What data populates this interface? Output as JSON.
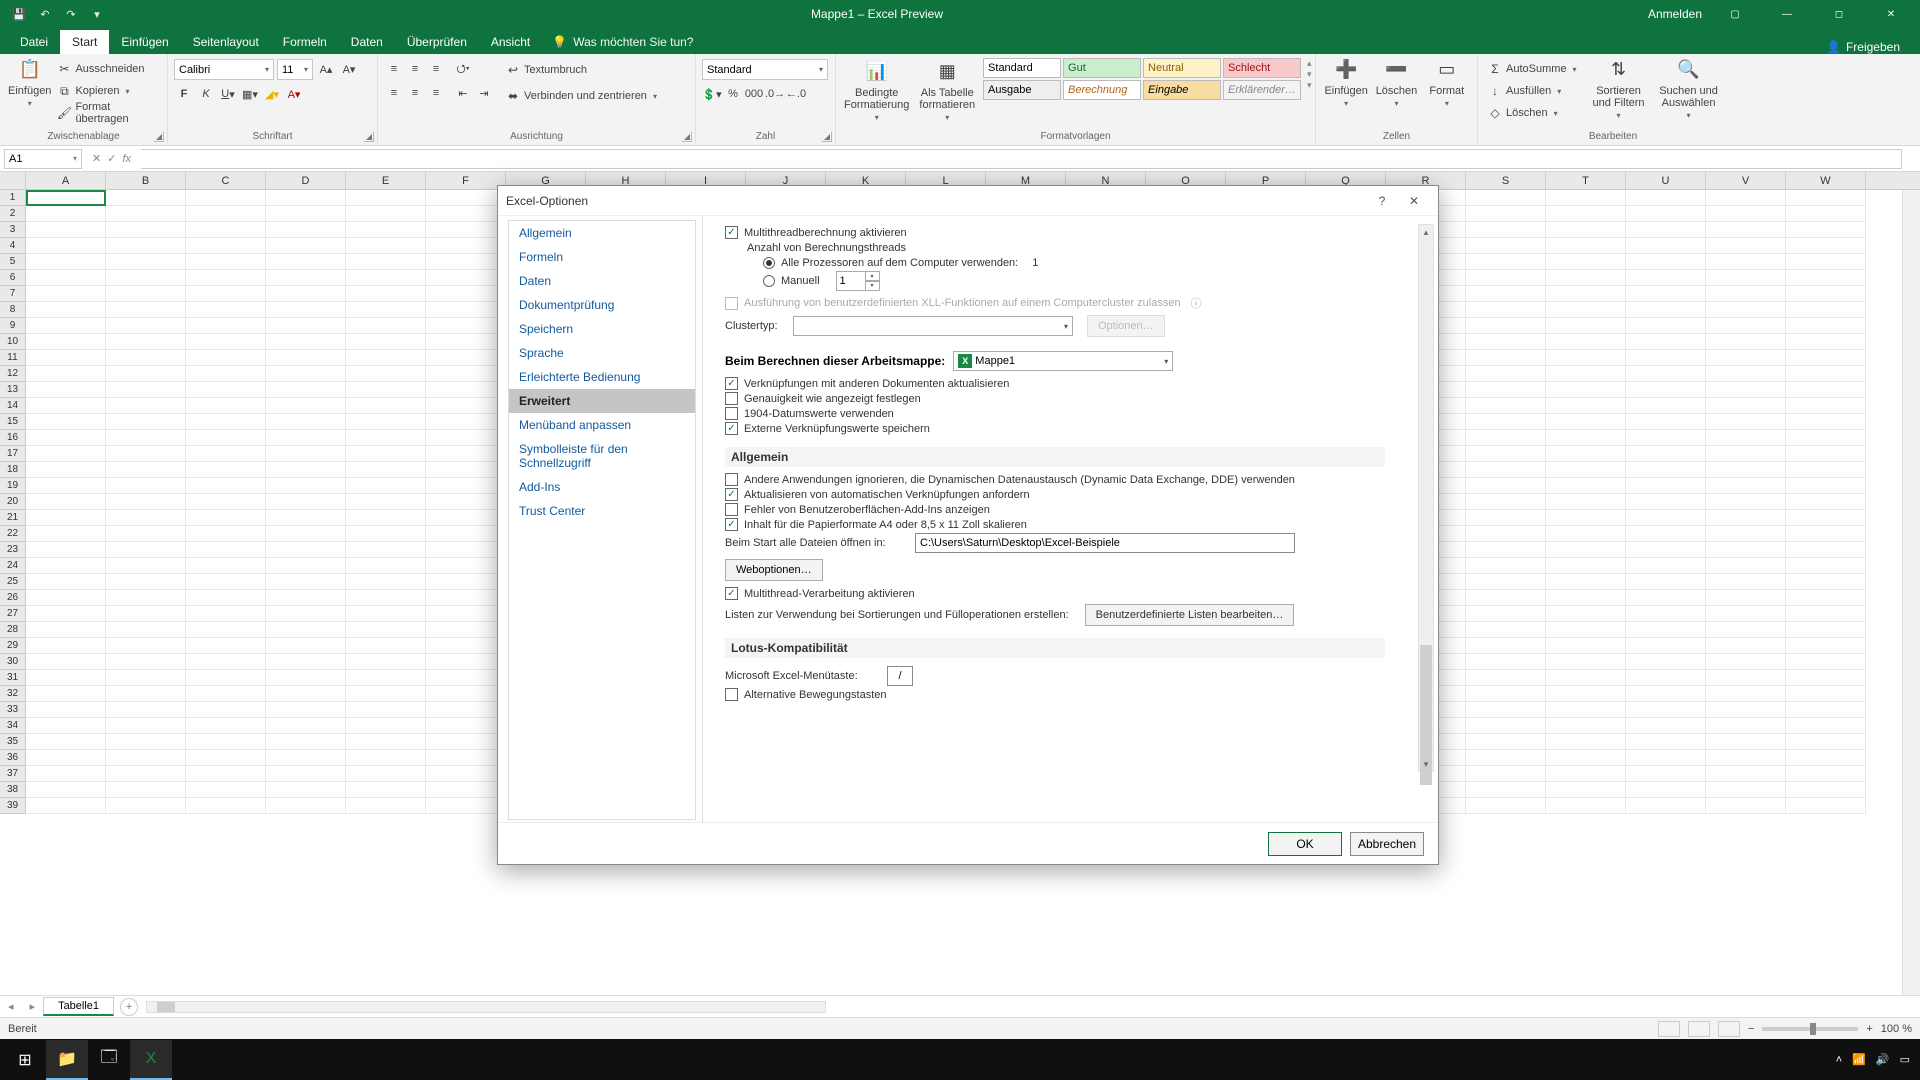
{
  "titlebar": {
    "title": "Mappe1  –  Excel Preview",
    "signin": "Anmelden"
  },
  "tabs": {
    "file": "Datei",
    "home": "Start",
    "insert": "Einfügen",
    "layout": "Seitenlayout",
    "formulas": "Formeln",
    "data": "Daten",
    "review": "Überprüfen",
    "view": "Ansicht",
    "tellme": "Was möchten Sie tun?",
    "share": "Freigeben"
  },
  "ribbon": {
    "clipboard": {
      "label": "Zwischenablage",
      "paste": "Einfügen",
      "cut": "Ausschneiden",
      "copy": "Kopieren",
      "painter": "Format übertragen"
    },
    "font": {
      "label": "Schriftart",
      "name": "Calibri",
      "size": "11"
    },
    "align": {
      "label": "Ausrichtung",
      "wrap": "Textumbruch",
      "merge": "Verbinden und zentrieren"
    },
    "number": {
      "label": "Zahl",
      "format": "Standard"
    },
    "styles": {
      "label": "Formatvorlagen",
      "cond": "Bedingte Formatierung",
      "table": "Als Tabelle formatieren",
      "standard": "Standard",
      "gut": "Gut",
      "neutral": "Neutral",
      "schlecht": "Schlecht",
      "ausgabe": "Ausgabe",
      "berechnung": "Berechnung",
      "eingabe": "Eingabe",
      "erkl": "Erklärender…"
    },
    "cells": {
      "label": "Zellen",
      "insert": "Einfügen",
      "delete": "Löschen",
      "format": "Format"
    },
    "editing": {
      "label": "Bearbeiten",
      "sum": "AutoSumme",
      "fill": "Ausfüllen",
      "clear": "Löschen",
      "sort": "Sortieren und Filtern",
      "find": "Suchen und Auswählen"
    }
  },
  "formula": {
    "cellref": "A1"
  },
  "sheet": {
    "tab": "Tabelle1"
  },
  "status": {
    "ready": "Bereit",
    "zoom": "100 %"
  },
  "dialog": {
    "title": "Excel-Optionen",
    "nav": [
      "Allgemein",
      "Formeln",
      "Daten",
      "Dokumentprüfung",
      "Speichern",
      "Sprache",
      "Erleichterte Bedienung",
      "Erweitert",
      "Menüband anpassen",
      "Symbolleiste für den Schnellzugriff",
      "Add-Ins",
      "Trust Center"
    ],
    "nav_active_index": 7,
    "threads": {
      "multithread": "Multithreadberechnung aktivieren",
      "count_label": "Anzahl von Berechnungsthreads",
      "all_cpu": "Alle Prozessoren auf dem Computer verwenden:",
      "all_cpu_val": "1",
      "manual": "Manuell",
      "manual_val": "1",
      "xll": "Ausführung von benutzerdefinierten XLL-Funktionen auf einem Computercluster zulassen",
      "clustertype": "Clustertyp:",
      "options": "Optionen…"
    },
    "calc": {
      "header": "Beim Berechnen dieser Arbeitsmappe:",
      "workbook": "Mappe1",
      "links": "Verknüpfungen mit anderen Dokumenten aktualisieren",
      "precision": "Genauigkeit wie angezeigt festlegen",
      "date1904": "1904-Datumswerte verwenden",
      "ext_links": "Externe Verknüpfungswerte speichern"
    },
    "general": {
      "header": "Allgemein",
      "dde": "Andere Anwendungen ignorieren, die Dynamischen Datenaustausch (Dynamic Data Exchange, DDE) verwenden",
      "ask_links": "Aktualisieren von automatischen Verknüpfungen anfordern",
      "addin_err": "Fehler von Benutzeroberflächen-Add-Ins anzeigen",
      "scale": "Inhalt für die Papierformate A4 oder 8,5 x 11 Zoll skalieren",
      "startup_lbl": "Beim Start alle Dateien öffnen in:",
      "startup_val": "C:\\Users\\Saturn\\Desktop\\Excel-Beispiele",
      "webopt": "Weboptionen…",
      "multithread_proc": "Multithread-Verarbeitung aktivieren",
      "lists_lbl": "Listen zur Verwendung bei Sortierungen und Fülloperationen erstellen:",
      "lists_btn": "Benutzerdefinierte Listen bearbeiten…"
    },
    "lotus": {
      "header": "Lotus-Kompatibilität",
      "menukey": "Microsoft Excel-Menütaste:",
      "menukey_val": "/",
      "altmove": "Alternative Bewegungstasten"
    },
    "ok": "OK",
    "cancel": "Abbrechen"
  }
}
